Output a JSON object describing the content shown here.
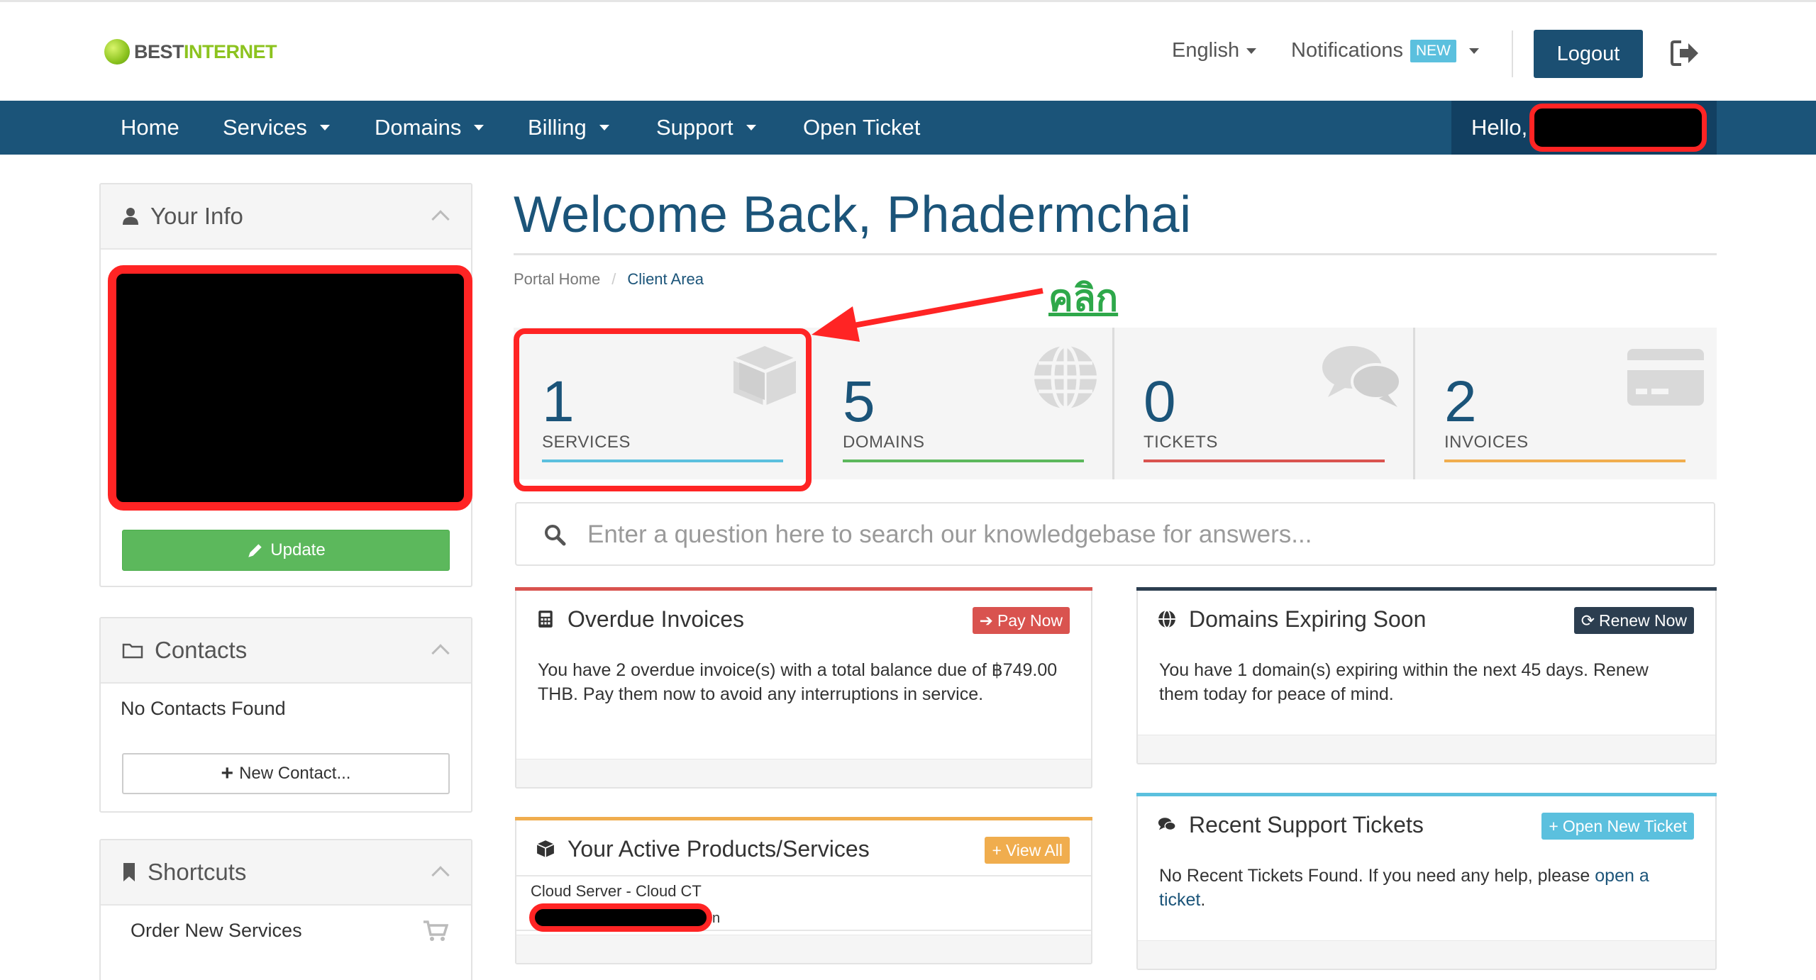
{
  "header": {
    "logo_part1": "BEST",
    "logo_part2": "INTERNET",
    "language": "English",
    "notifications": "Notifications",
    "notifications_badge": "NEW",
    "logout": "Logout"
  },
  "nav": {
    "items": [
      "Home",
      "Services",
      "Domains",
      "Billing",
      "Support",
      "Open Ticket"
    ],
    "hello": "Hello,"
  },
  "sidebar": {
    "your_info": {
      "title": "Your Info",
      "update": "Update"
    },
    "contacts": {
      "title": "Contacts",
      "empty": "No Contacts Found",
      "new_contact": "New Contact..."
    },
    "shortcuts": {
      "title": "Shortcuts",
      "order_new": "Order New Services"
    }
  },
  "main": {
    "welcome": "Welcome Back, Phadermchai",
    "breadcrumb": [
      "Portal Home",
      "Client Area"
    ],
    "annotation": "คลิก",
    "stats": [
      {
        "count": "1",
        "label": "SERVICES",
        "color": "#5bc0de",
        "icon": "cube-icon"
      },
      {
        "count": "5",
        "label": "DOMAINS",
        "color": "#5cb85c",
        "icon": "globe-icon"
      },
      {
        "count": "0",
        "label": "TICKETS",
        "color": "#d9534f",
        "icon": "comments-icon"
      },
      {
        "count": "2",
        "label": "INVOICES",
        "color": "#f0ad4e",
        "icon": "credit-card-icon"
      }
    ],
    "kb_placeholder": "Enter a question here to search our knowledgebase for answers..."
  },
  "cards": {
    "overdue": {
      "title": "Overdue Invoices",
      "button": "Pay Now",
      "body": "You have 2 overdue invoice(s) with a total balance due of ฿749.00 THB. Pay them now to avoid any interruptions in service."
    },
    "domains": {
      "title": "Domains Expiring Soon",
      "button": "Renew Now",
      "body": "You have 1 domain(s) expiring within the next 45 days. Renew them today for peace of mind."
    },
    "products": {
      "title": "Your Active Products/Services",
      "button": "View All",
      "service_name": "Cloud Server - Cloud CT",
      "service_tail": "n"
    },
    "tickets": {
      "title": "Recent Support Tickets",
      "button": "Open New Ticket",
      "body": "No Recent Tickets Found. If you need any help, please ",
      "link": "open a ticket",
      "end": "."
    }
  },
  "colors": {
    "brand": "#1b5479",
    "nav_bg": "#1b5479",
    "success": "#5cb85c",
    "danger": "#d9534f",
    "warning": "#f0ad4e",
    "info": "#5bc0de",
    "annotation_red": "#ff2424",
    "annotation_green": "#2ea84a"
  }
}
